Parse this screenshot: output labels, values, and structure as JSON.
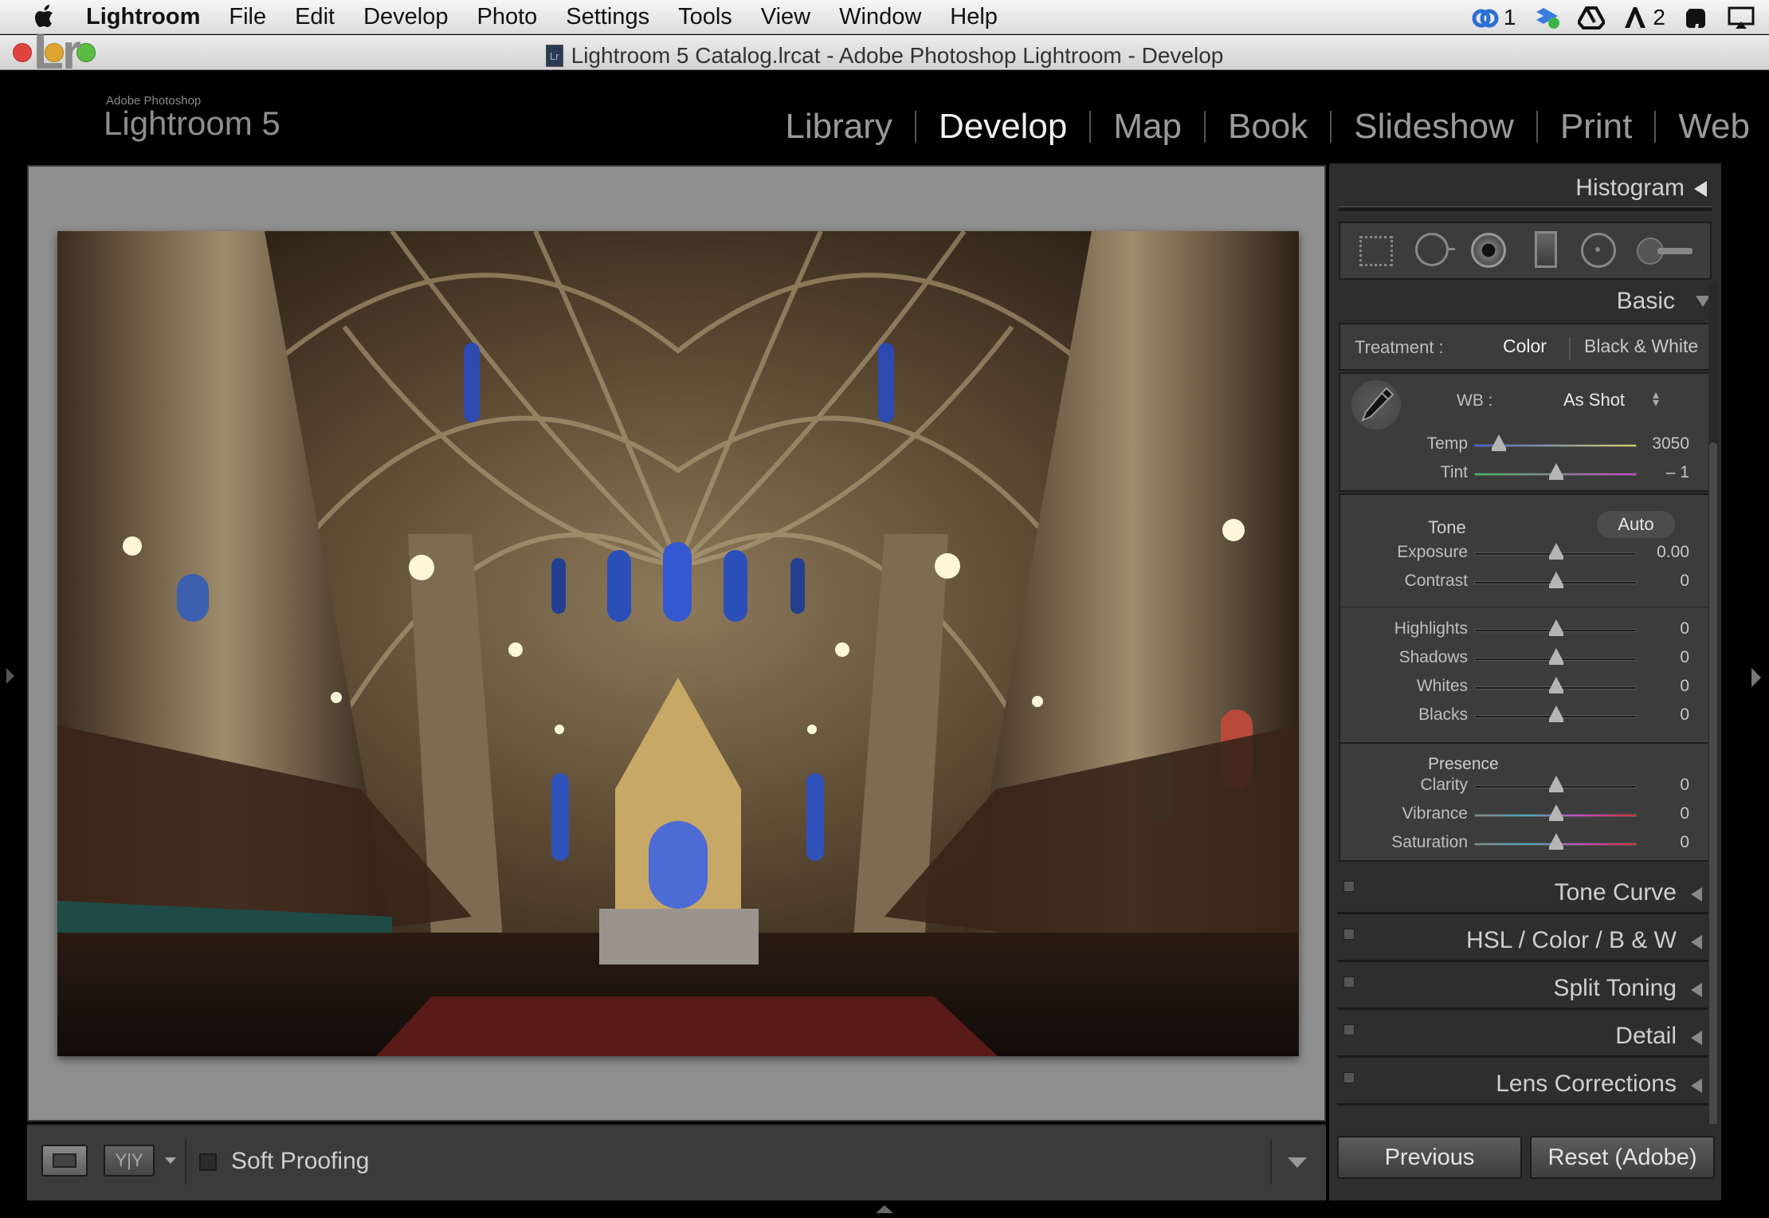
{
  "menubar": {
    "app": "Lightroom",
    "items": [
      "File",
      "Edit",
      "Develop",
      "Photo",
      "Settings",
      "Tools",
      "View",
      "Window",
      "Help"
    ],
    "right": {
      "cc_count": "1",
      "adobe_count": "2"
    }
  },
  "window": {
    "title": "Lightroom 5 Catalog.lrcat - Adobe Photoshop Lightroom - Develop"
  },
  "identity": {
    "logo": "Lr",
    "brand_small": "Adobe Photoshop",
    "product": "Lightroom 5"
  },
  "modules": [
    "Library",
    "Develop",
    "Map",
    "Book",
    "Slideshow",
    "Print",
    "Web"
  ],
  "active_module": "Develop",
  "panel": {
    "histogram": "Histogram",
    "basic": "Basic",
    "treatment": {
      "label": "Treatment :",
      "color": "Color",
      "bw": "Black & White"
    },
    "wb": {
      "label": "WB :",
      "value": "As Shot"
    },
    "temp": {
      "label": "Temp",
      "value": "3050",
      "pos": 0.15
    },
    "tint": {
      "label": "Tint",
      "value": "– 1",
      "pos": 0.5
    },
    "tone": {
      "label": "Tone",
      "auto": "Auto"
    },
    "sliders_tone": [
      {
        "label": "Exposure",
        "value": "0.00",
        "pos": 0.5
      },
      {
        "label": "Contrast",
        "value": "0",
        "pos": 0.5
      }
    ],
    "sliders_tone2": [
      {
        "label": "Highlights",
        "value": "0",
        "pos": 0.5
      },
      {
        "label": "Shadows",
        "value": "0",
        "pos": 0.5
      },
      {
        "label": "Whites",
        "value": "0",
        "pos": 0.5
      },
      {
        "label": "Blacks",
        "value": "0",
        "pos": 0.5
      }
    ],
    "presence": {
      "label": "Presence"
    },
    "sliders_presence": [
      {
        "label": "Clarity",
        "value": "0",
        "pos": 0.5
      },
      {
        "label": "Vibrance",
        "value": "0",
        "pos": 0.5
      },
      {
        "label": "Saturation",
        "value": "0",
        "pos": 0.5
      }
    ],
    "collapsed": [
      "Tone Curve",
      "HSL / Color / B & W",
      "Split Toning",
      "Detail",
      "Lens Corrections"
    ],
    "previous": "Previous",
    "reset": "Reset (Adobe)"
  },
  "toolbar": {
    "soft_proofing": "Soft Proofing"
  }
}
